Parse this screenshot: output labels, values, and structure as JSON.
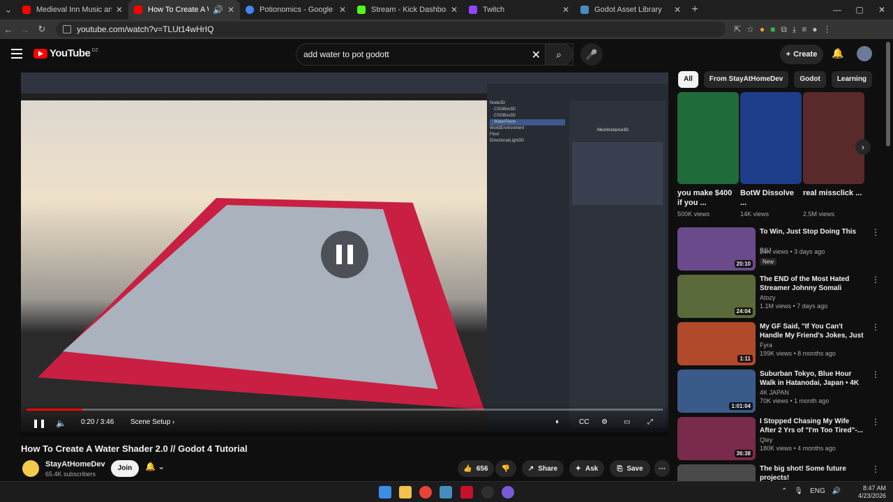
{
  "browser": {
    "tabs": [
      {
        "title": "Medieval Inn Music and Fantasy",
        "color": "#ff0000"
      },
      {
        "title": "How To Create A Water Sha",
        "color": "#ff0000",
        "active": true
      },
      {
        "title": "Potionomics - Google Search",
        "color": "#4285f4"
      },
      {
        "title": "Stream - Kick Dashboard",
        "color": "#53fc18"
      },
      {
        "title": "Twitch",
        "color": "#9146ff"
      },
      {
        "title": "Godot Asset Library",
        "color": "#478cbf"
      }
    ],
    "url": "youtube.com/watch?v=TLUt14wHrIQ"
  },
  "header": {
    "logo": "YouTube",
    "country": "DZ",
    "search_query": "add water to pot godott",
    "create_label": "Create"
  },
  "player": {
    "time": "0:20 / 3:46",
    "chapter": "Scene Setup",
    "progress_fraction": 0.088,
    "editor_scene_items": [
      "Node3D",
      "CSGBox3D",
      "CSGBox3D",
      "WaterPlane",
      "WorldEnvironment",
      "Floor",
      "DirectionalLight3D"
    ],
    "inspector_node": "MeshInstance3D"
  },
  "video": {
    "title": "How To Create A Water Shader 2.0 // Godot 4 Tutorial",
    "channel": "StayAtHomeDev",
    "subscribers": "65.4K subscribers",
    "join_label": "Join",
    "likes": "656",
    "share_label": "Share",
    "ask_label": "Ask",
    "save_label": "Save"
  },
  "chips": [
    "All",
    "From StayAtHomeDev",
    "Godot",
    "Learning"
  ],
  "shorts": [
    {
      "title": "you make $400 if you ...",
      "views": "500K views",
      "color": "#1f6b3a"
    },
    {
      "title": "BotW Dissolve ...",
      "views": "14K views",
      "color": "#1d3c8a"
    },
    {
      "title": "real missclick ...",
      "views": "2.5M views",
      "color": "#5a2a2a"
    }
  ],
  "recommendations": [
    {
      "title": "To Win, Just Stop Doing This",
      "channel": "BSJ",
      "meta": "24K views • 3 days ago",
      "badge": "New",
      "duration": "20:10",
      "color": "#6a4a8a"
    },
    {
      "title": "The END of the Most Hated Streamer Johnny Somali",
      "channel": "Atozy",
      "meta": "1.1M views • 7 days ago",
      "duration": "24:04",
      "color": "#5a6a3a"
    },
    {
      "title": "My GF Said, \"If You Can't Handle My Friend's Jokes, Just Pay & ...",
      "channel": "Fyra",
      "meta": "199K views • 8 months ago",
      "duration": "1:11",
      "color": "#b04a2a"
    },
    {
      "title": "Suburban Tokyo, Blue Hour Walk in Hatanodai, Japan • 4K ...",
      "channel": "4K JAPAN",
      "meta": "70K views • 1 month ago",
      "duration": "1:01:04",
      "color": "#3a5a8a"
    },
    {
      "title": "I Stopped Chasing My Wife After 2 Yrs of \"I'm Too Tired\"-...",
      "channel": "Qley",
      "meta": "180K views • 4 months ago",
      "duration": "36:38",
      "color": "#7a2a4a"
    },
    {
      "title": "The big shot! Some future projects!",
      "channel": "",
      "meta": "",
      "duration": "",
      "color": "#4a4a4a"
    }
  ],
  "taskbar": {
    "lang": "ENG",
    "time": "8:47 AM",
    "date": "4/23/2026"
  }
}
